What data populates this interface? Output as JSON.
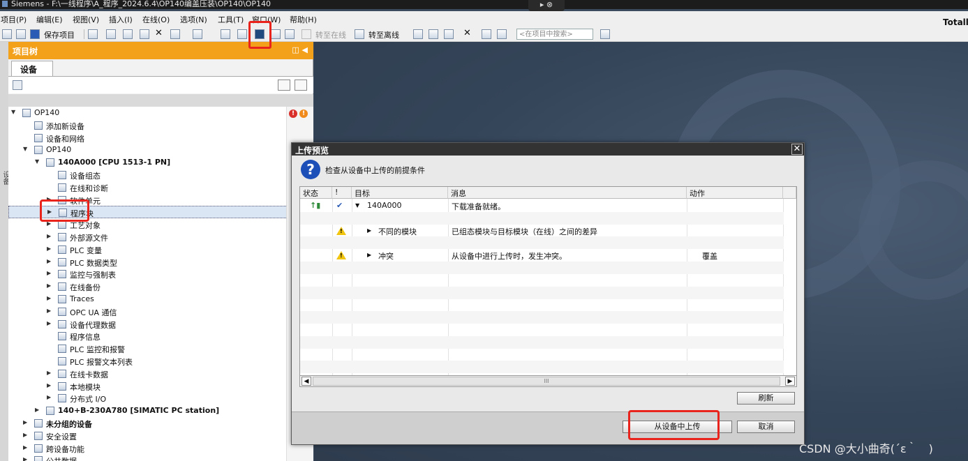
{
  "titlebar": {
    "text": "Siemens  -  F:\\一线程序\\A_程序_2024.6.4\\OP140编盖压装\\OP140\\OP140"
  },
  "titlebar_mini": "▸ ⊗",
  "menu": [
    "项目(P)",
    "编辑(E)",
    "视图(V)",
    "插入(I)",
    "在线(O)",
    "选项(N)",
    "工具(T)",
    "窗口(W)",
    "帮助(H)"
  ],
  "brand": "Totally",
  "toolbar": {
    "save": "保存项目",
    "go_online": "转至在线",
    "go_offline": "转至离线",
    "search_placeholder": "<在项目中搜索>"
  },
  "project_tree": {
    "title": "项目树",
    "tab": "设备",
    "side_label": "设备",
    "items": [
      {
        "label": "OP140",
        "level": 0,
        "arrow": "▼",
        "bold": false
      },
      {
        "label": "添加新设备",
        "level": 1,
        "arrow": "",
        "bold": false
      },
      {
        "label": "设备和网络",
        "level": 1,
        "arrow": "",
        "bold": false
      },
      {
        "label": "OP140",
        "level": 1,
        "arrow": "▼",
        "bold": false
      },
      {
        "label": "140A000 [CPU 1513-1 PN]",
        "level": 2,
        "arrow": "▼",
        "bold": true
      },
      {
        "label": "设备组态",
        "level": 3,
        "arrow": "",
        "bold": false
      },
      {
        "label": "在线和诊断",
        "level": 3,
        "arrow": "",
        "bold": false
      },
      {
        "label": "软件单元",
        "level": 3,
        "arrow": "▶",
        "bold": false
      },
      {
        "label": "程序块",
        "level": 3,
        "arrow": "▶",
        "bold": false,
        "selected": true
      },
      {
        "label": "工艺对象",
        "level": 3,
        "arrow": "▶",
        "bold": false
      },
      {
        "label": "外部源文件",
        "level": 3,
        "arrow": "▶",
        "bold": false
      },
      {
        "label": "PLC 变量",
        "level": 3,
        "arrow": "▶",
        "bold": false
      },
      {
        "label": "PLC 数据类型",
        "level": 3,
        "arrow": "▶",
        "bold": false
      },
      {
        "label": "监控与强制表",
        "level": 3,
        "arrow": "▶",
        "bold": false
      },
      {
        "label": "在线备份",
        "level": 3,
        "arrow": "▶",
        "bold": false
      },
      {
        "label": "Traces",
        "level": 3,
        "arrow": "▶",
        "bold": false
      },
      {
        "label": "OPC UA 通信",
        "level": 3,
        "arrow": "▶",
        "bold": false
      },
      {
        "label": "设备代理数据",
        "level": 3,
        "arrow": "▶",
        "bold": false
      },
      {
        "label": "程序信息",
        "level": 3,
        "arrow": "",
        "bold": false
      },
      {
        "label": "PLC 监控和报警",
        "level": 3,
        "arrow": "",
        "bold": false
      },
      {
        "label": "PLC 报警文本列表",
        "level": 3,
        "arrow": "",
        "bold": false
      },
      {
        "label": "在线卡数据",
        "level": 3,
        "arrow": "▶",
        "bold": false
      },
      {
        "label": "本地模块",
        "level": 3,
        "arrow": "▶",
        "bold": false
      },
      {
        "label": "分布式 I/O",
        "level": 3,
        "arrow": "▶",
        "bold": false
      },
      {
        "label": "140+B-230A780 [SIMATIC PC station]",
        "level": 2,
        "arrow": "▶",
        "bold": true
      },
      {
        "label": "未分组的设备",
        "level": 1,
        "arrow": "▶",
        "bold": true
      },
      {
        "label": "安全设置",
        "level": 1,
        "arrow": "▶",
        "bold": false
      },
      {
        "label": "跨设备功能",
        "level": 1,
        "arrow": "▶",
        "bold": false
      },
      {
        "label": "公共数据",
        "level": 1,
        "arrow": "▶",
        "bold": false
      }
    ]
  },
  "dialog": {
    "title": "上传预览",
    "close": "✕",
    "header": "检查从设备中上传的前提条件",
    "columns": [
      "状态",
      "!",
      "目标",
      "消息",
      "动作"
    ],
    "rows": [
      {
        "target": "140A000",
        "message": "下载准备就绪。",
        "action": "",
        "arrow": "▼",
        "status": "ok"
      },
      {
        "target": "",
        "message": "",
        "action": "",
        "arrow": "",
        "status": ""
      },
      {
        "target": "不同的模块",
        "message": "已组态模块与目标模块（在线）之间的差异",
        "action": "",
        "arrow": "▶",
        "status": "warn"
      },
      {
        "target": "",
        "message": "",
        "action": "",
        "arrow": "",
        "status": ""
      },
      {
        "target": "冲突",
        "message": "从设备中进行上传时，发生冲突。",
        "action": "覆盖",
        "arrow": "▶",
        "status": "warn"
      }
    ],
    "refresh": "刷新",
    "upload": "从设备中上传",
    "cancel": "取消"
  },
  "watermark": "CSDN @大小曲奇(´ε｀　)",
  "colors": {
    "accent": "#f3a11b",
    "highlight": "#e8241c",
    "dialog_title": "#333333"
  }
}
